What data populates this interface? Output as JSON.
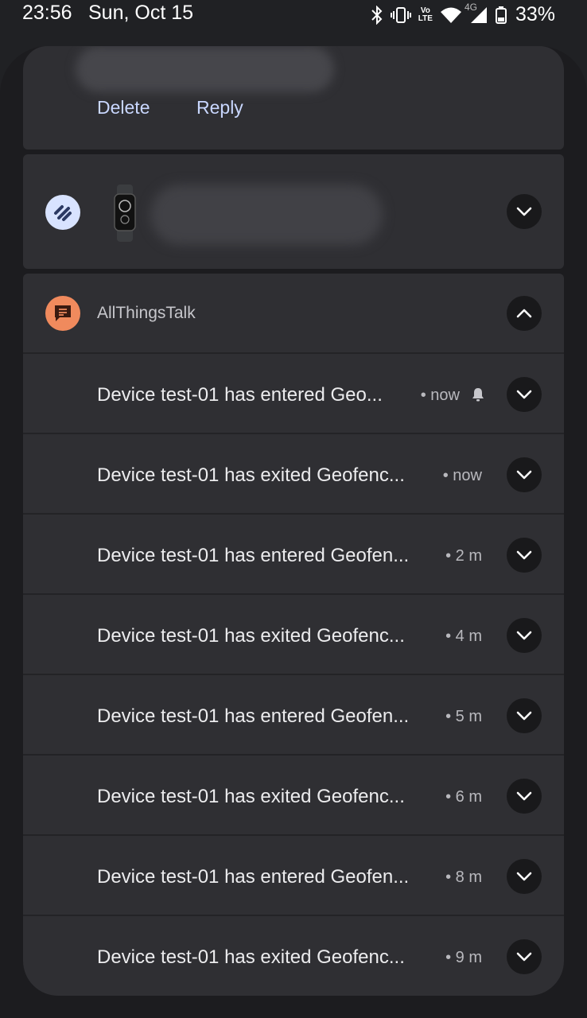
{
  "status_bar": {
    "time": "23:56",
    "date": "Sun, Oct 15",
    "network_label_top": "Vo",
    "network_label_bottom": "LTE",
    "signal_label": "4G",
    "battery": "33%",
    "icons": [
      "bluetooth-icon",
      "vibrate-icon",
      "volte-icon",
      "wifi-icon",
      "signal-icon",
      "battery-icon"
    ]
  },
  "message_card": {
    "actions": [
      "Delete",
      "Reply"
    ]
  },
  "fitness_card": {
    "app_icon": "fitness-app-icon",
    "image": "smart-band-image"
  },
  "allthingstalk_group": {
    "app_name": "AllThingsTalk",
    "accent": "#f08a5d",
    "notifications": [
      {
        "title": "Device test-01 has entered Geo...",
        "time": "• now",
        "alerting": true
      },
      {
        "title": "Device test-01 has exited Geofenc...",
        "time": "• now",
        "alerting": false
      },
      {
        "title": "Device test-01 has entered Geofen...",
        "time": "• 2 m",
        "alerting": false
      },
      {
        "title": "Device test-01 has exited Geofenc...",
        "time": "• 4 m",
        "alerting": false
      },
      {
        "title": "Device test-01 has entered Geofen...",
        "time": "• 5 m",
        "alerting": false
      },
      {
        "title": "Device test-01 has exited Geofenc...",
        "time": "• 6 m",
        "alerting": false
      },
      {
        "title": "Device test-01 has entered Geofen...",
        "time": "• 8 m",
        "alerting": false
      },
      {
        "title": "Device test-01 has exited Geofenc...",
        "time": "• 9 m",
        "alerting": false
      }
    ]
  }
}
